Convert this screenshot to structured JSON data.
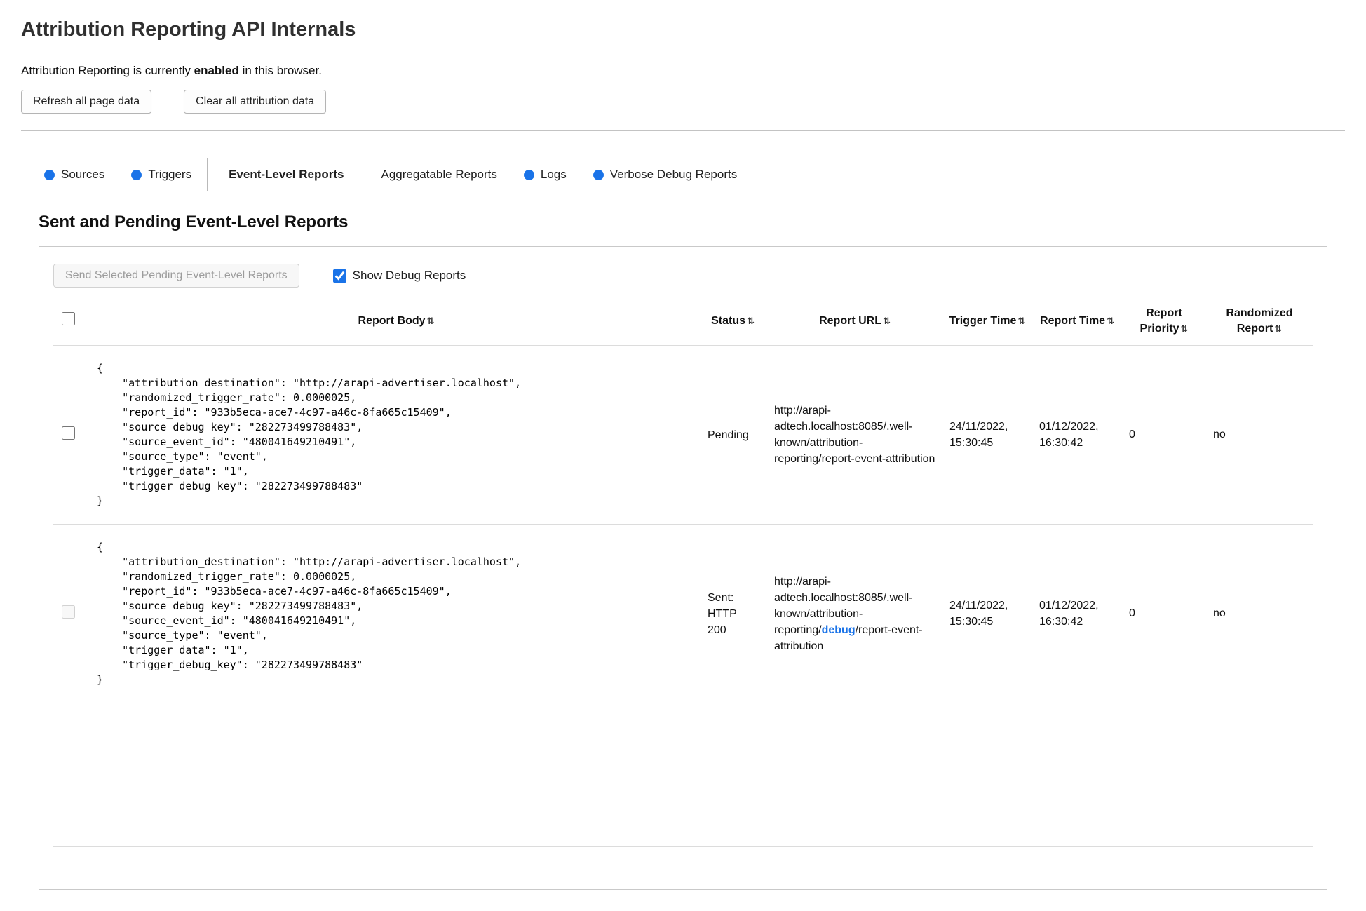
{
  "page": {
    "title": "Attribution Reporting API Internals",
    "status_prefix": "Attribution Reporting is currently ",
    "status_bold": "enabled",
    "status_suffix": " in this browser."
  },
  "toolbar": {
    "refresh_label": "Refresh all page data",
    "clear_label": "Clear all attribution data"
  },
  "colors": {
    "accent_blue": "#1a73e8"
  },
  "tabs": [
    {
      "label": "Sources",
      "has_dot": true,
      "active": false
    },
    {
      "label": "Triggers",
      "has_dot": true,
      "active": false
    },
    {
      "label": "Event-Level Reports",
      "has_dot": false,
      "active": true
    },
    {
      "label": "Aggregatable Reports",
      "has_dot": false,
      "active": false
    },
    {
      "label": "Logs",
      "has_dot": true,
      "active": false
    },
    {
      "label": "Verbose Debug Reports",
      "has_dot": true,
      "active": false
    }
  ],
  "section": {
    "heading": "Sent and Pending Event-Level Reports",
    "send_button_label": "Send Selected Pending Event-Level Reports",
    "send_button_disabled_attr": "disabled",
    "show_debug_label": "Show Debug Reports",
    "show_debug_checked_attr": "checked"
  },
  "table": {
    "sort_icon": "⇅",
    "columns": [
      "Report Body",
      "Status",
      "Report URL",
      "Trigger Time",
      "Report Time",
      "Report Priority",
      "Randomized Report"
    ],
    "rows": [
      {
        "report_body": "{\n    \"attribution_destination\": \"http://arapi-advertiser.localhost\",\n    \"randomized_trigger_rate\": 0.0000025,\n    \"report_id\": \"933b5eca-ace7-4c97-a46c-8fa665c15409\",\n    \"source_debug_key\": \"282273499788483\",\n    \"source_event_id\": \"480041649210491\",\n    \"source_type\": \"event\",\n    \"trigger_data\": \"1\",\n    \"trigger_debug_key\": \"282273499788483\"\n}",
        "status": "Pending",
        "url_prefix": "http://arapi-adtech.localhost:8085/.well-known/attribution-reporting/report-event-attribution",
        "url_debug": "",
        "url_suffix": "",
        "trigger_time": "24/11/2022, 15:30:45",
        "report_time": "01/12/2022, 16:30:42",
        "report_priority": "0",
        "randomized_report": "no"
      },
      {
        "checkbox_disabled_attr": "disabled",
        "report_body": "{\n    \"attribution_destination\": \"http://arapi-advertiser.localhost\",\n    \"randomized_trigger_rate\": 0.0000025,\n    \"report_id\": \"933b5eca-ace7-4c97-a46c-8fa665c15409\",\n    \"source_debug_key\": \"282273499788483\",\n    \"source_event_id\": \"480041649210491\",\n    \"source_type\": \"event\",\n    \"trigger_data\": \"1\",\n    \"trigger_debug_key\": \"282273499788483\"\n}",
        "status": "Sent: HTTP 200",
        "url_prefix": "http://arapi-adtech.localhost:8085/.well-known/attribution-reporting/",
        "url_debug": "debug",
        "url_suffix": "/report-event-attribution",
        "trigger_time": "24/11/2022, 15:30:45",
        "report_time": "01/12/2022, 16:30:42",
        "report_priority": "0",
        "randomized_report": "no"
      }
    ]
  }
}
